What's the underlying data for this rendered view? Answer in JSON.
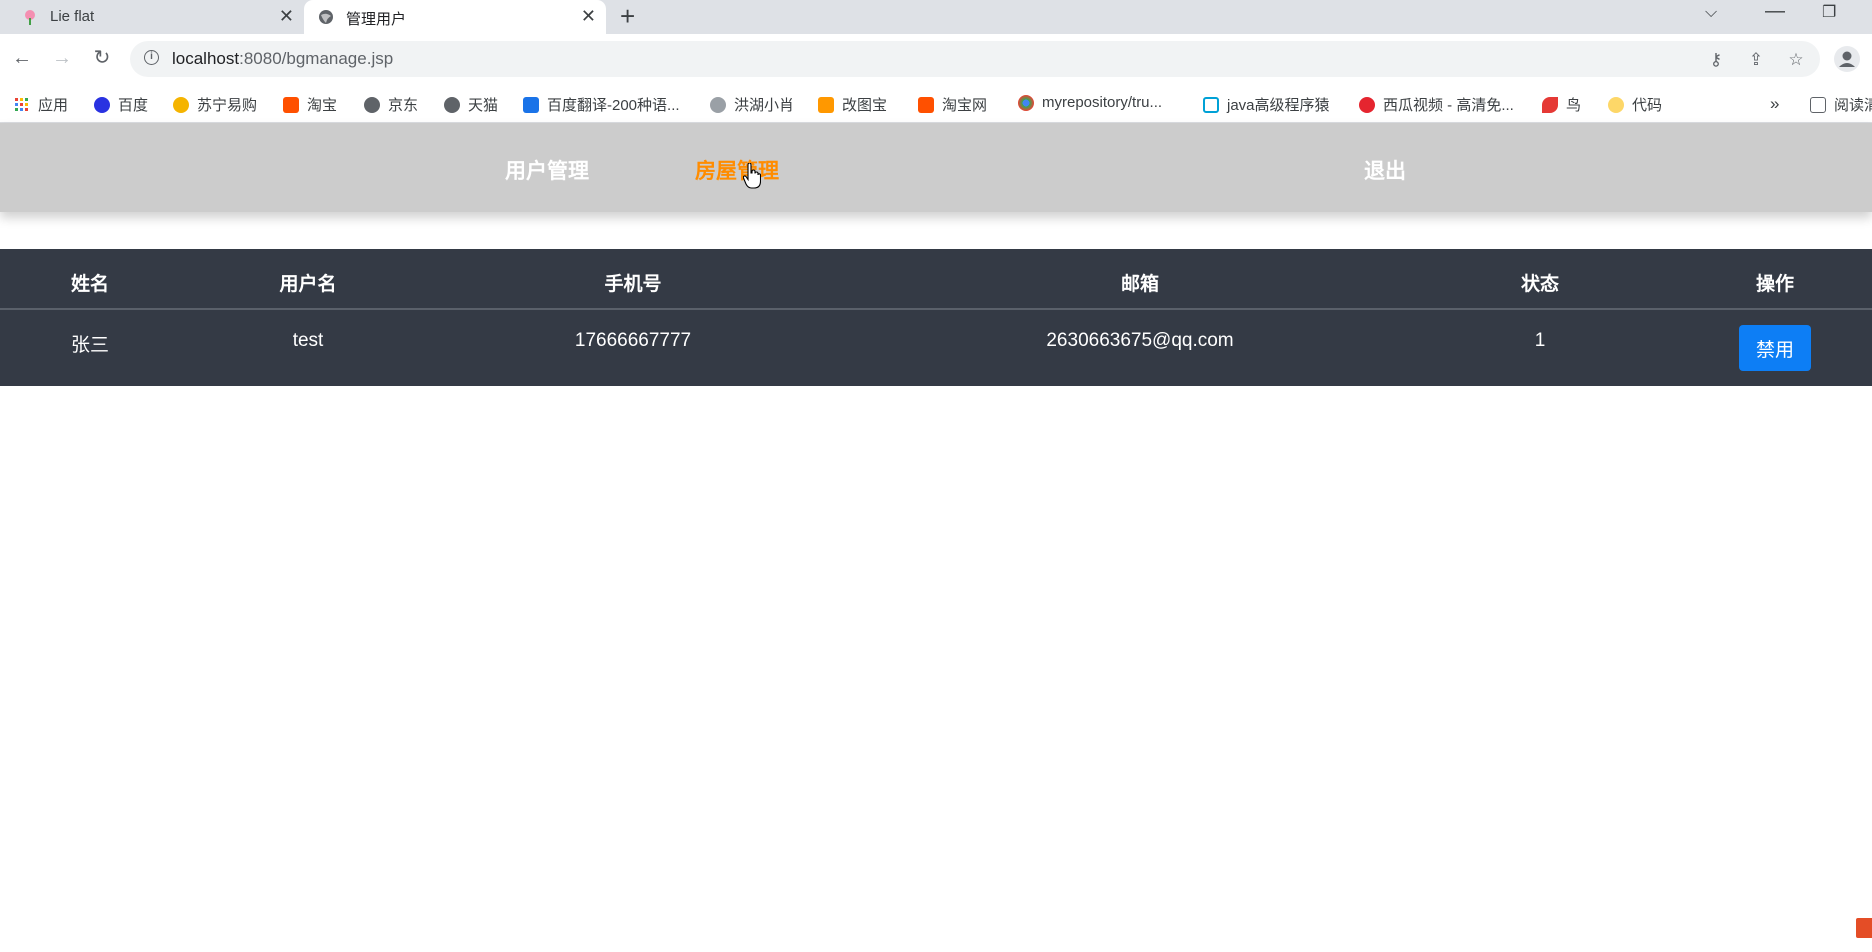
{
  "browser": {
    "tabs": [
      {
        "title": "Lie flat",
        "active": false
      },
      {
        "title": "管理用户",
        "active": true
      }
    ],
    "url_host": "localhost",
    "url_path": ":8080/bgmanage.jsp",
    "bookmarks": [
      {
        "label": "应用",
        "icon": "apps-grid-icon",
        "color": "#ea4335"
      },
      {
        "label": "百度",
        "icon": "baidu-icon",
        "color": "#2932e1"
      },
      {
        "label": "苏宁易购",
        "icon": "suning-icon",
        "color": "#f5b400"
      },
      {
        "label": "淘宝",
        "icon": "taobao-icon",
        "color": "#ff5000"
      },
      {
        "label": "京东",
        "icon": "globe-icon",
        "color": "#5f6368"
      },
      {
        "label": "天猫",
        "icon": "globe-icon",
        "color": "#5f6368"
      },
      {
        "label": "百度翻译-200种语...",
        "icon": "translate-icon",
        "color": "#1a73e8"
      },
      {
        "label": "洪湖小肖",
        "icon": "bird-icon",
        "color": "#5f6368"
      },
      {
        "label": "改图宝",
        "icon": "gaitubao-icon",
        "color": "#ff9800"
      },
      {
        "label": "淘宝网",
        "icon": "taobao-icon",
        "color": "#ff5000"
      },
      {
        "label": "myrepository/tru...",
        "icon": "chrome-icon",
        "color": "#34a853"
      },
      {
        "label": "java高级程序猿",
        "icon": "bilibili-icon",
        "color": "#00a1d6"
      },
      {
        "label": "西瓜视频 - 高清免...",
        "icon": "xigua-icon",
        "color": "#e5252f"
      },
      {
        "label": "鸟",
        "icon": "bird-icon",
        "color": "#e53935"
      },
      {
        "label": "代码",
        "icon": "code-icon",
        "color": "#fbbc04"
      }
    ],
    "more_bookmarks": "»",
    "reading_list": "阅读清"
  },
  "nav": {
    "user_mgmt": "用户管理",
    "house_mgmt": "房屋管理",
    "logout": "退出",
    "active_color": "#ff8c00"
  },
  "table": {
    "headers": [
      "姓名",
      "用户名",
      "手机号",
      "邮箱",
      "状态",
      "操作"
    ],
    "rows": [
      {
        "name": "张三",
        "username": "test",
        "phone": "17666667777",
        "email": "2630663675@qq.com",
        "status": "1",
        "action": "禁用"
      }
    ]
  }
}
